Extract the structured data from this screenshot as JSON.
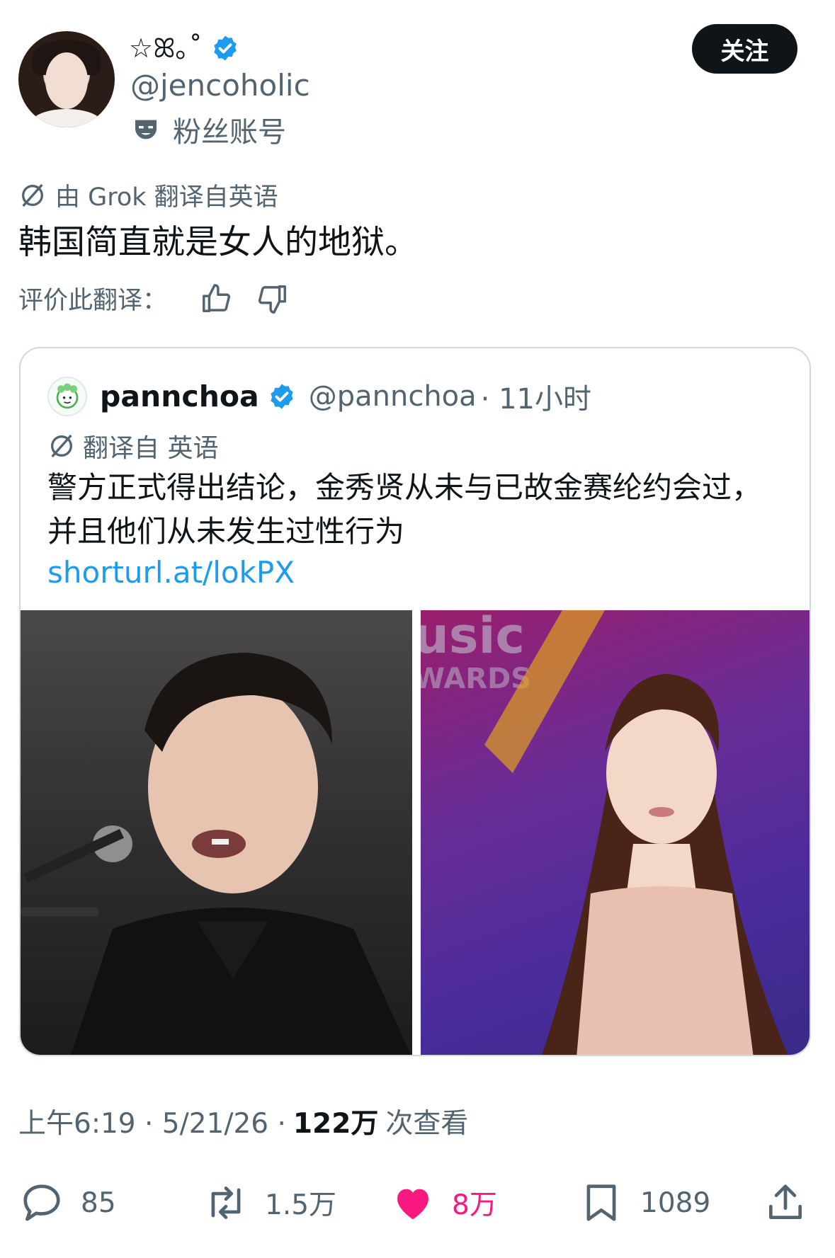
{
  "author": {
    "display_name": "☆ꕤ｡˚",
    "handle": "@jencoholic",
    "account_label": "粉丝账号",
    "follow_label": "关注"
  },
  "translation": {
    "source_label": "由 Grok 翻译自英语",
    "text": "韩国简直就是女人的地狱。",
    "rate_label": "评价此翻译："
  },
  "quote": {
    "name": "pannchoa",
    "handle": "@pannchoa",
    "time": "· 11小时",
    "translated_label": "翻译自 英语",
    "text": "警方正式得出结论，金秀贤从未与已故金赛纶约会过，并且他们从未发生过性行为",
    "link": "shorturl.at/lokPX"
  },
  "meta": {
    "time": "上午6:19 · 5/21/26 ·",
    "views": "122万",
    "views_label": "次查看"
  },
  "actions": {
    "replies": "85",
    "reposts": "1.5万",
    "likes": "8万",
    "bookmarks": "1089"
  },
  "colors": {
    "verified": "#1d9bf0",
    "like": "#f91880",
    "link": "#1d9bf0",
    "secondary_text": "#536471"
  },
  "icons": [
    "verified-badge-icon",
    "fan-account-mask-icon",
    "translate-icon",
    "thumbs-up-icon",
    "thumbs-down-icon",
    "reply-icon",
    "repost-icon",
    "like-heart-icon",
    "bookmark-icon",
    "share-icon"
  ]
}
